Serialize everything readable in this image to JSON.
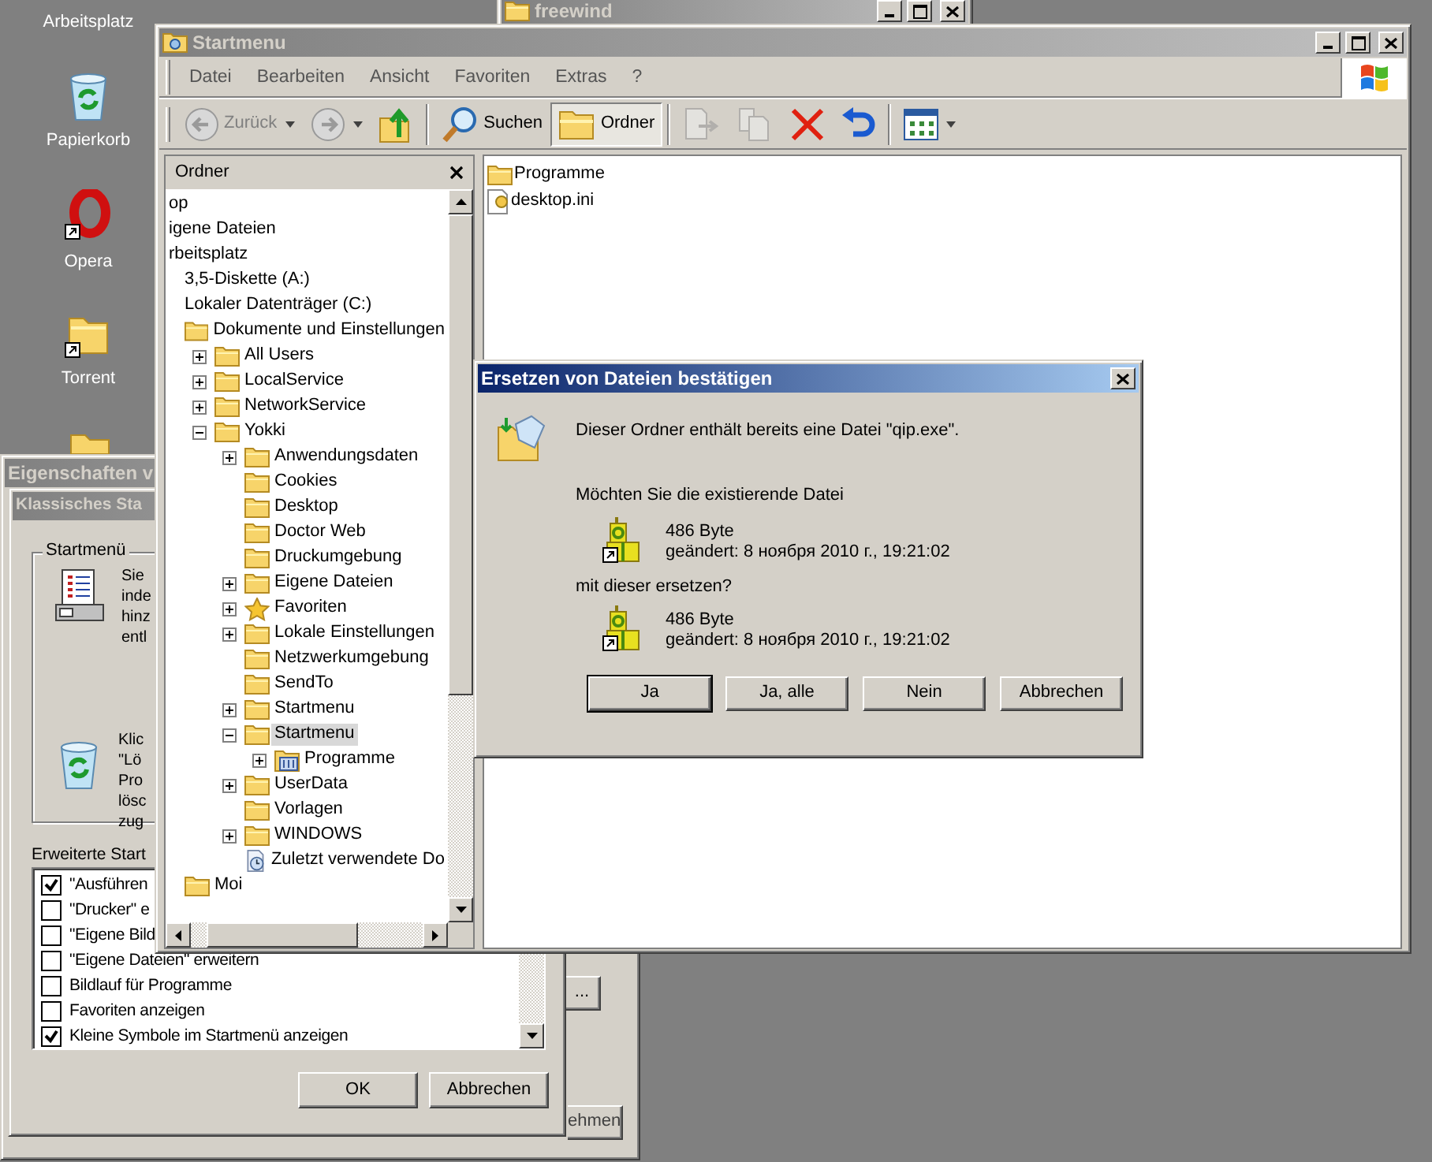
{
  "desktop_icons": [
    {
      "label": "Arbeitsplatz"
    },
    {
      "label": "Papierkorb",
      "kind": "recycle",
      "shortcut": false
    },
    {
      "label": "Opera",
      "kind": "opera",
      "shortcut": true
    },
    {
      "label": "Torrent",
      "kind": "folder",
      "shortcut": true
    }
  ],
  "background_window": {
    "title": "freewind",
    "active": false
  },
  "properties_window": {
    "title": "Eigenschaften v",
    "active": false,
    "buttons": [
      "...",
      "ehmen"
    ]
  },
  "customize_dialog": {
    "title": "Klassisches Sta",
    "active": false,
    "group": {
      "title": "Startmenü",
      "sections": [
        {
          "kind": "list",
          "text_lines": [
            "Sie",
            "inde",
            "hinz",
            "entl"
          ]
        },
        {
          "kind": "recycle",
          "text_lines": [
            "Klic",
            "\"Lö",
            "Pro",
            "lösc",
            "zug"
          ]
        }
      ]
    },
    "options_label": "Erweiterte Start",
    "options": [
      {
        "label": "\"Ausführen",
        "checked": true
      },
      {
        "label": "\"Drucker\" e",
        "checked": false
      },
      {
        "label": "\"Eigene Bild",
        "checked": false
      },
      {
        "label": "\"Eigene Dateien\" erweitern",
        "checked": false
      },
      {
        "label": "Bildlauf für Programme",
        "checked": false
      },
      {
        "label": "Favoriten anzeigen",
        "checked": false
      },
      {
        "label": "Kleine Symbole im Startmenü anzeigen",
        "checked": true
      }
    ],
    "buttons": [
      "OK",
      "Abbrechen"
    ]
  },
  "explorer": {
    "title": "Startmenu",
    "active": false,
    "menu": [
      "Datei",
      "Bearbeiten",
      "Ansicht",
      "Favoriten",
      "Extras",
      "?"
    ],
    "toolbar": [
      {
        "kind": "back",
        "label": "Zurück",
        "disabled": true,
        "pressed": false
      },
      {
        "kind": "forward",
        "disabled": true,
        "pressed": false
      },
      {
        "kind": "up",
        "disabled": false,
        "pressed": false
      },
      {
        "kind": "search",
        "label": "Suchen",
        "disabled": false,
        "pressed": false
      },
      {
        "kind": "folders",
        "label": "Ordner",
        "disabled": false,
        "pressed": true
      },
      {
        "kind": "move",
        "disabled": true,
        "pressed": false
      },
      {
        "kind": "copy",
        "disabled": true,
        "pressed": false
      },
      {
        "kind": "delete",
        "disabled": false,
        "pressed": false
      },
      {
        "kind": "undo",
        "disabled": false,
        "pressed": false
      },
      {
        "kind": "views",
        "disabled": false,
        "pressed": false
      }
    ],
    "folder_pane": {
      "title": "Ordner",
      "tree": [
        {
          "label": "op",
          "selected": false,
          "children": [
            {
              "label": "igene Dateien",
              "selected": false
            },
            {
              "label": "rbeitsplatz",
              "selected": false,
              "children": [
                {
                  "label": "3,5-Diskette (A:)",
                  "selected": false
                },
                {
                  "label": "Lokaler Datenträger (C:)",
                  "selected": false,
                  "children": [
                    {
                      "label": "Dokumente und Einstellungen",
                      "kind": "folder",
                      "selected": false,
                      "children": [
                        {
                          "label": "All Users",
                          "kind": "folder",
                          "expanded": false,
                          "selected": false
                        },
                        {
                          "label": "LocalService",
                          "kind": "folder",
                          "expanded": false,
                          "selected": false
                        },
                        {
                          "label": "NetworkService",
                          "kind": "folder",
                          "expanded": false,
                          "selected": false
                        },
                        {
                          "label": "Yokki",
                          "kind": "folder",
                          "expanded": true,
                          "selected": false,
                          "children": [
                            {
                              "label": "Anwendungsdaten",
                              "kind": "folder",
                              "expanded": false,
                              "selected": false
                            },
                            {
                              "label": "Cookies",
                              "kind": "folder",
                              "selected": false
                            },
                            {
                              "label": "Desktop",
                              "kind": "folder",
                              "selected": false
                            },
                            {
                              "label": "Doctor Web",
                              "kind": "folder",
                              "selected": false
                            },
                            {
                              "label": "Druckumgebung",
                              "kind": "folder",
                              "selected": false
                            },
                            {
                              "label": "Eigene Dateien",
                              "kind": "folder",
                              "expanded": false,
                              "selected": false
                            },
                            {
                              "label": "Favoriten",
                              "kind": "favorites",
                              "expanded": false,
                              "selected": false
                            },
                            {
                              "label": "Lokale Einstellungen",
                              "kind": "folder",
                              "expanded": false,
                              "selected": false
                            },
                            {
                              "label": "Netzwerkumgebung",
                              "kind": "folder",
                              "selected": false
                            },
                            {
                              "label": "SendTo",
                              "kind": "folder",
                              "selected": false
                            },
                            {
                              "label": "Startmenu",
                              "kind": "folder",
                              "expanded": false,
                              "selected": false
                            },
                            {
                              "label": "Startmenu",
                              "kind": "folder",
                              "expanded": true,
                              "selected": true,
                              "children": [
                                {
                                  "label": "Programme",
                                  "kind": "programs",
                                  "expanded": false,
                                  "selected": false
                                }
                              ]
                            },
                            {
                              "label": "UserData",
                              "kind": "folder",
                              "expanded": false,
                              "selected": false
                            },
                            {
                              "label": "Vorlagen",
                              "kind": "folder",
                              "selected": false
                            },
                            {
                              "label": "WINDOWS",
                              "kind": "folder",
                              "expanded": false,
                              "selected": false
                            },
                            {
                              "label": "Zuletzt verwendete Do",
                              "kind": "recent",
                              "selected": false
                            }
                          ]
                        }
                      ]
                    },
                    {
                      "label": "Moi",
                      "kind": "folder",
                      "selected": false
                    }
                  ]
                }
              ]
            }
          ]
        }
      ]
    },
    "files": [
      {
        "name": "Programme",
        "kind": "folder"
      },
      {
        "name": "desktop.ini",
        "kind": "settings"
      }
    ]
  },
  "confirm_dialog": {
    "title": "Ersetzen von Dateien bestätigen",
    "active": true,
    "message": "Dieser Ordner enthält bereits eine Datei \"qip.exe\".",
    "question": "Möchten Sie die existierende Datei",
    "existing": {
      "size": "486 Byte",
      "modified": "geändert: 8 ноября 2010 г., 19:21:02"
    },
    "replace_prompt": "mit dieser ersetzen?",
    "replacement": {
      "size": "486 Byte",
      "modified": "geändert: 8 ноября 2010 г., 19:21:02"
    },
    "buttons": [
      {
        "label": "Ja",
        "default": true
      },
      {
        "label": "Ja, alle",
        "default": false
      },
      {
        "label": "Nein",
        "default": false
      },
      {
        "label": "Abbrechen",
        "default": false
      }
    ]
  }
}
